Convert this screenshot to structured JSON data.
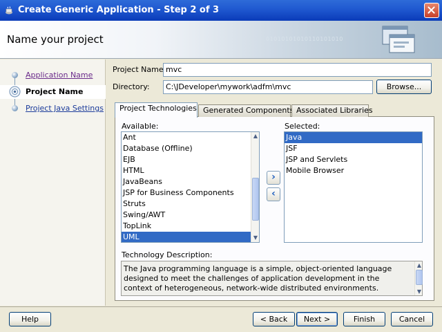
{
  "window": {
    "title": "Create Generic Application - Step 2 of 3"
  },
  "header": {
    "page_title": "Name your project",
    "decoration_text": "01010101010110101010"
  },
  "steps": [
    {
      "label": "Application Name",
      "state": "visited"
    },
    {
      "label": "Project Name",
      "state": "current"
    },
    {
      "label": "Project Java Settings",
      "state": "link"
    }
  ],
  "form": {
    "project_name_label": "Project Name:",
    "project_name_value": "mvc",
    "directory_label": "Directory:",
    "directory_value": "C:\\JDeveloper\\mywork\\adfm\\mvc",
    "browse_label": "Browse..."
  },
  "tabs": [
    {
      "label": "Project Technologies",
      "active": true
    },
    {
      "label": "Generated Components",
      "active": false
    },
    {
      "label": "Associated Libraries",
      "active": false
    }
  ],
  "available": {
    "label": "Available:",
    "items": [
      "Ant",
      "Database (Offline)",
      "EJB",
      "HTML",
      "JavaBeans",
      "JSP for Business Components",
      "Struts",
      "Swing/AWT",
      "TopLink",
      "UML"
    ],
    "selected": "UML"
  },
  "selected_list": {
    "label": "Selected:",
    "items": [
      "Java",
      "JSF",
      "JSP and Servlets",
      "Mobile Browser"
    ],
    "selected": "Java"
  },
  "move_buttons": {
    "add": "›",
    "remove": "‹"
  },
  "description": {
    "label": "Technology Description:",
    "text": "The Java programming language is a simple, object-oriented language designed to meet the challenges of application development in the context of heterogeneous, network-wide distributed environments."
  },
  "buttons": {
    "help": "Help",
    "back": "< Back",
    "next": "Next >",
    "finish": "Finish",
    "cancel": "Cancel"
  },
  "colors": {
    "titlebar": "#0a3bb8",
    "selection": "#316ac5",
    "window_bg": "#ece9d8"
  }
}
